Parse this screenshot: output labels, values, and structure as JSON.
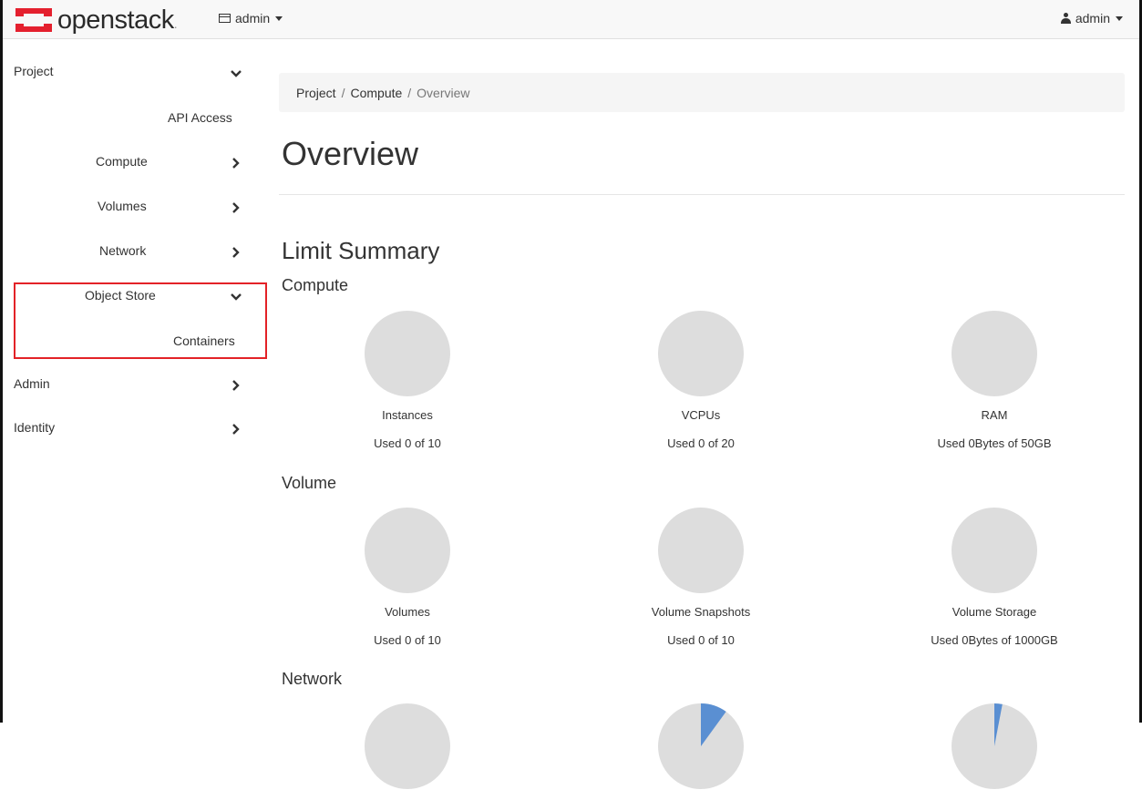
{
  "navbar": {
    "brand": "openstack",
    "brand_dot": ".",
    "project_selector": "admin",
    "user_menu": "admin"
  },
  "sidebar": {
    "project": "Project",
    "api_access": "API Access",
    "compute": "Compute",
    "volumes": "Volumes",
    "network": "Network",
    "object_store": "Object Store",
    "containers": "Containers",
    "admin": "Admin",
    "identity": "Identity"
  },
  "breadcrumb": {
    "item1": "Project",
    "sep": "/",
    "item2": "Compute",
    "item3": "Overview"
  },
  "page": {
    "title": "Overview",
    "limit_summary": "Limit Summary"
  },
  "sections": {
    "compute": {
      "title": "Compute",
      "items": [
        {
          "label": "Instances",
          "usage": "Used 0 of 10",
          "fraction": 0
        },
        {
          "label": "VCPUs",
          "usage": "Used 0 of 20",
          "fraction": 0
        },
        {
          "label": "RAM",
          "usage": "Used 0Bytes of 50GB",
          "fraction": 0
        }
      ]
    },
    "volume": {
      "title": "Volume",
      "items": [
        {
          "label": "Volumes",
          "usage": "Used 0 of 10",
          "fraction": 0
        },
        {
          "label": "Volume Snapshots",
          "usage": "Used 0 of 10",
          "fraction": 0
        },
        {
          "label": "Volume Storage",
          "usage": "Used 0Bytes of 1000GB",
          "fraction": 0
        }
      ]
    },
    "network": {
      "title": "Network",
      "items": [
        {
          "fraction": 0
        },
        {
          "fraction": 0.1
        },
        {
          "fraction": 0.03
        }
      ]
    }
  },
  "colors": {
    "pie_empty": "#dddddd",
    "pie_used": "#5a8fd2",
    "highlight": "#e32227",
    "brand_red": "#e4202e"
  }
}
